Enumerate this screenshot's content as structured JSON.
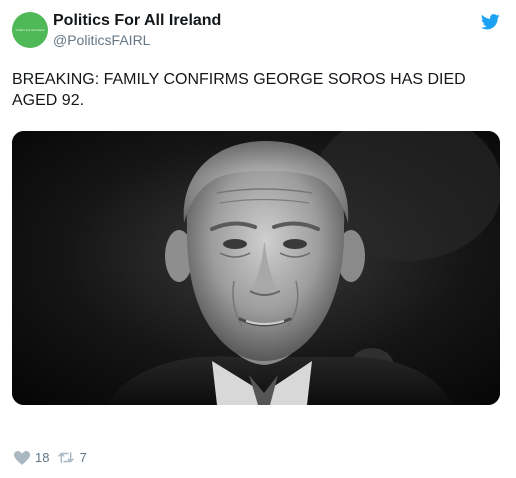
{
  "tweet": {
    "author": {
      "display_name": "Politics For All Ireland",
      "handle": "@PoliticsFAIRL",
      "avatar_text": "Politics For All Ireland"
    },
    "text": "BREAKING: FAMILY CONFIRMS GEORGE SOROS HAS DIED AGED 92.",
    "media": {
      "alt": "Black and white portrait photo of an elderly man",
      "style": "black-and-white portrait"
    },
    "stats": {
      "likes": "18",
      "retweets": "7"
    }
  },
  "icons": {
    "brand": "twitter-bird-icon",
    "like": "heart-icon",
    "retweet": "retweet-icon"
  },
  "colors": {
    "brand_blue": "#1da1f2",
    "avatar_green": "#4fb957",
    "muted_text": "#657786",
    "text": "#14171a"
  }
}
